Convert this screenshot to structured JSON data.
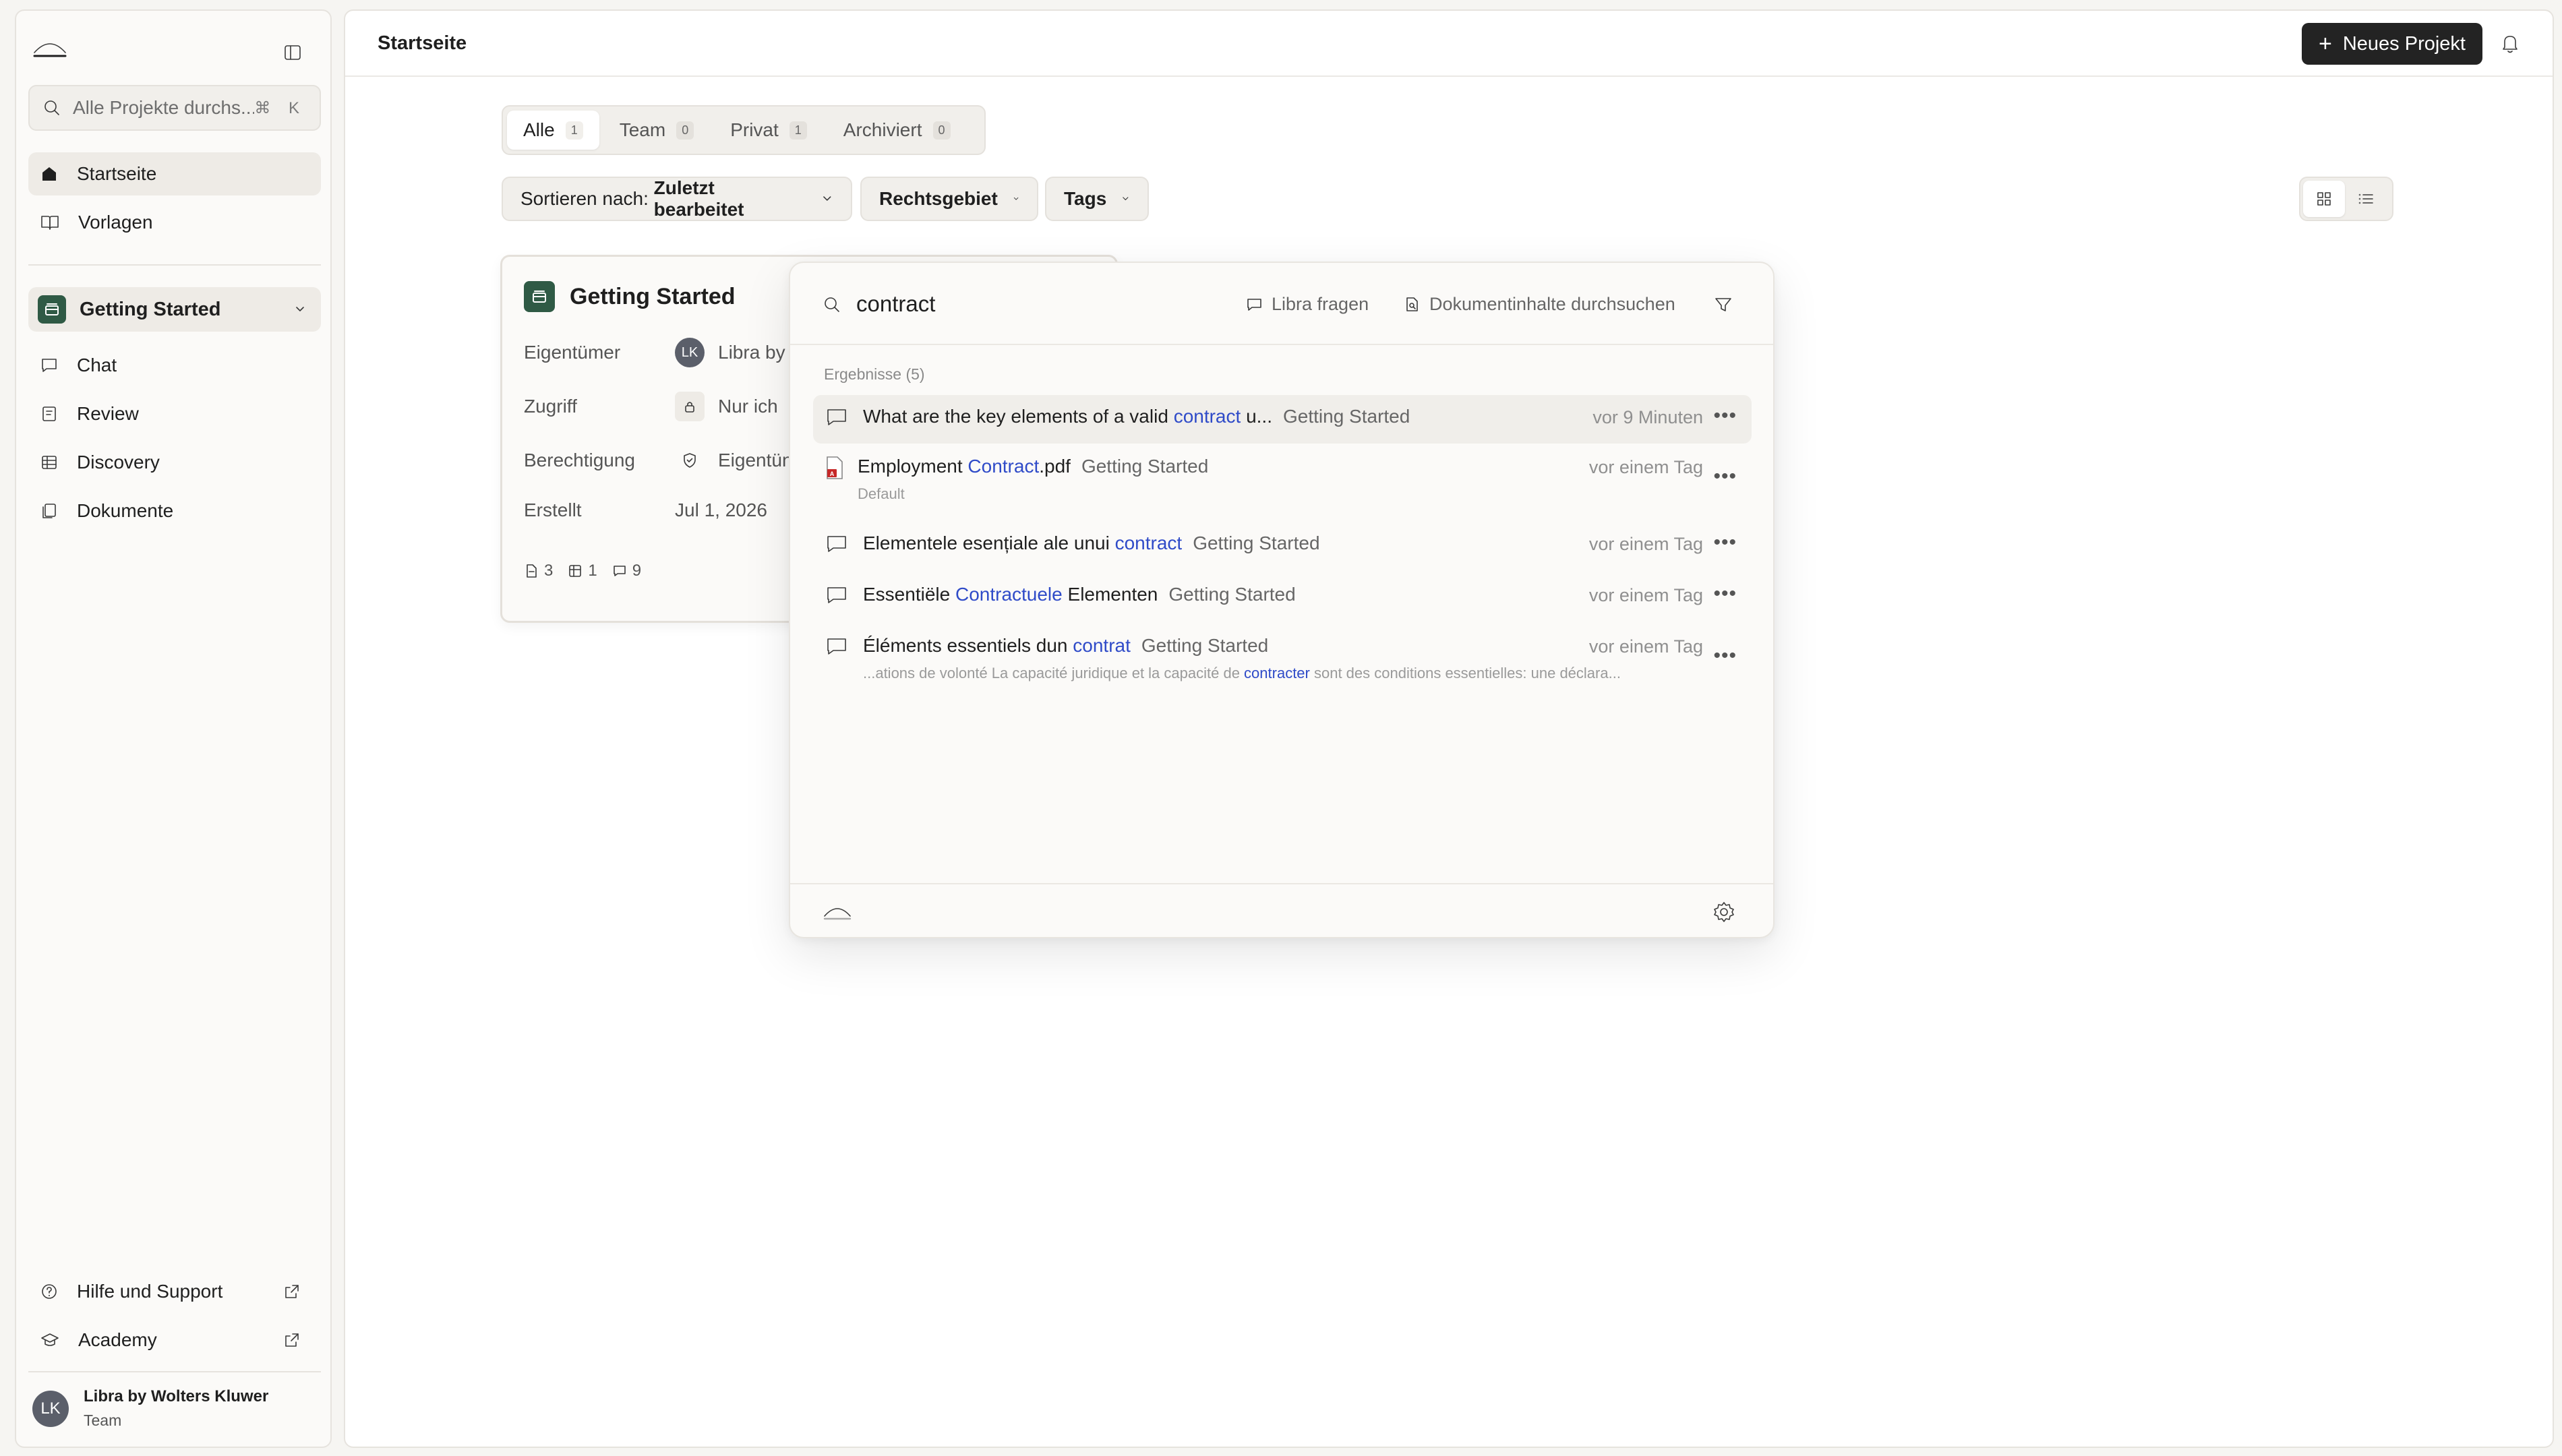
{
  "sidebar": {
    "search_placeholder": "Alle Projekte durchs...",
    "search_shortcut": "⌘ K",
    "nav": [
      {
        "label": "Startseite",
        "icon": "home-icon"
      },
      {
        "label": "Vorlagen",
        "icon": "book-icon"
      }
    ],
    "project": {
      "label": "Getting Started",
      "icon": "folder-icon"
    },
    "project_nav": [
      {
        "label": "Chat",
        "icon": "chat-icon"
      },
      {
        "label": "Review",
        "icon": "review-icon"
      },
      {
        "label": "Discovery",
        "icon": "table-icon"
      },
      {
        "label": "Dokumente",
        "icon": "documents-icon"
      }
    ],
    "footer_links": [
      {
        "label": "Hilfe und Support",
        "icon": "help-icon"
      },
      {
        "label": "Academy",
        "icon": "graduation-icon"
      }
    ],
    "user": {
      "initials": "LK",
      "name": "Libra by Wolters Kluwer",
      "role": "Team"
    }
  },
  "header": {
    "title": "Startseite",
    "new_project_label": "Neues Projekt"
  },
  "tabs": [
    {
      "label": "Alle",
      "count": "1",
      "active": true
    },
    {
      "label": "Team",
      "count": "0",
      "active": false
    },
    {
      "label": "Privat",
      "count": "1",
      "active": false
    },
    {
      "label": "Archiviert",
      "count": "0",
      "active": false
    }
  ],
  "filters": {
    "sort_prefix": "Sortieren nach: ",
    "sort_value": "Zuletzt bearbeitet",
    "area": "Rechtsgebiet",
    "tags": "Tags"
  },
  "card": {
    "title": "Getting Started",
    "rows": [
      {
        "key": "Eigentümer",
        "value": "Libra by",
        "avatar": "LK"
      },
      {
        "key": "Zugriff",
        "value": "Nur ich"
      },
      {
        "key": "Berechtigung",
        "value": "Eigentün"
      },
      {
        "key": "Erstellt",
        "value": "Jul 1, 2026"
      }
    ],
    "stats": {
      "documents": "3",
      "tables": "1",
      "chats": "9"
    }
  },
  "search_popup": {
    "query": "contract",
    "ask_label": "Libra fragen",
    "search_docs_label": "Dokumentinhalte durchsuchen",
    "results_label": "Ergebnisse (5)",
    "results": [
      {
        "pre": "What are the key elements of a valid ",
        "match": "contract",
        "post": " u...",
        "project": "Getting Started",
        "time": "vor 9 Minuten",
        "type": "chat",
        "sub": null
      },
      {
        "pre": "Employment ",
        "match": "Contract",
        "post": ".pdf",
        "project": "Getting Started",
        "time": "vor einem Tag",
        "type": "pdf",
        "sub": {
          "pre": "Default",
          "match": "",
          "post": ""
        }
      },
      {
        "pre": "Elementele esențiale ale unui ",
        "match": "contract",
        "post": "",
        "project": "Getting Started",
        "time": "vor einem Tag",
        "type": "chat",
        "sub": null
      },
      {
        "pre": "Essentiële ",
        "match": "Contractuele",
        "post": " Elementen",
        "project": "Getting Started",
        "time": "vor einem Tag",
        "type": "chat",
        "sub": null
      },
      {
        "pre": "Éléments essentiels dun ",
        "match": "contrat",
        "post": "",
        "project": "Getting Started",
        "time": "vor einem Tag",
        "type": "chat",
        "sub": {
          "pre": "...ations de volonté La capacité juridique et la capacité de ",
          "match": "contracter",
          "post": " sont des conditions essentielles: une déclara..."
        }
      }
    ]
  },
  "colors": {
    "accent_dark": "#232323",
    "project_green": "#2f5a45",
    "match_blue": "#2f4bc8"
  }
}
